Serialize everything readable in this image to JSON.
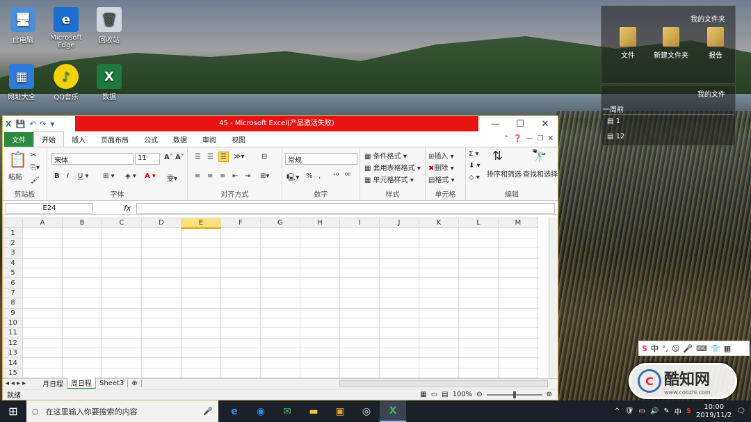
{
  "desktop": {
    "icons": [
      {
        "label": "此电脑",
        "icon": "computer-icon"
      },
      {
        "label": "Microsoft Edge",
        "icon": "edge-icon"
      },
      {
        "label": "回收站",
        "icon": "recycle-bin-icon"
      },
      {
        "label": "网址大全",
        "icon": "web-directory-icon"
      },
      {
        "label": "QQ音乐",
        "icon": "qq-music-icon"
      },
      {
        "label": "数据",
        "icon": "excel-file-icon"
      }
    ],
    "fence1": {
      "title": "我的文件夹",
      "items": [
        "文件",
        "新建文件夹",
        "报告"
      ]
    },
    "fence2": {
      "title": "我的文件",
      "section": "一周前",
      "items": [
        "1",
        "12"
      ]
    }
  },
  "excel": {
    "title": "45 - Microsoft Excel(产品激活失败)",
    "tabs": [
      "文件",
      "开始",
      "插入",
      "页面布局",
      "公式",
      "数据",
      "审阅",
      "视图"
    ],
    "ribbon": {
      "clipboard": {
        "paste": "粘贴",
        "label": "剪贴板"
      },
      "font": {
        "name": "宋体",
        "size": "11",
        "label": "字体"
      },
      "alignment": {
        "label": "对齐方式"
      },
      "number": {
        "format": "常规",
        "label": "数字"
      },
      "styles": {
        "items": [
          "条件格式",
          "套用表格格式",
          "单元格样式"
        ],
        "label": "样式"
      },
      "cells": {
        "items": [
          "插入",
          "删除",
          "格式"
        ],
        "label": "单元格"
      },
      "editing": {
        "sort": "排序和筛选",
        "find": "查找和选择",
        "label": "编辑"
      }
    },
    "namebox": "E24",
    "fx": "fx",
    "columns": [
      "A",
      "B",
      "C",
      "D",
      "E",
      "F",
      "G",
      "H",
      "I",
      "J",
      "K",
      "L",
      "M"
    ],
    "selected_column": "E",
    "rows": [
      "1",
      "2",
      "3",
      "4",
      "5",
      "6",
      "7",
      "8",
      "9",
      "10",
      "11",
      "12",
      "13",
      "14",
      "15"
    ],
    "sheets": [
      "月日程",
      "周日程",
      "Sheet3"
    ],
    "active_sheet": "周日程",
    "status": "就绪",
    "zoom": "100%"
  },
  "ime": {
    "lang": "中"
  },
  "watermark": {
    "brand": "酷知网",
    "url": "www.coozhi.com"
  },
  "taskbar": {
    "search_placeholder": "在这里输入你要搜索的内容",
    "apps": [
      "edge-icon",
      "sogou-icon",
      "wechat-icon",
      "file-explorer-icon",
      "image-viewer-icon",
      "browser-icon",
      "excel-icon"
    ],
    "ime": "中",
    "date": "2019/11/2",
    "time": "10:00"
  }
}
